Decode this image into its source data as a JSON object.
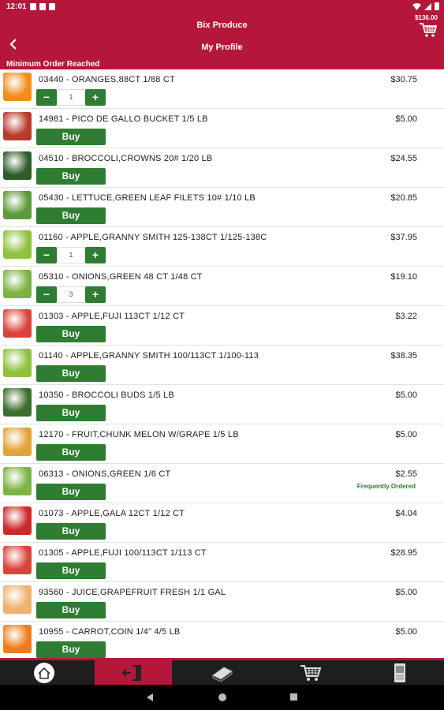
{
  "status_bar": {
    "time": "12:01"
  },
  "header": {
    "app_title": "Bix Produce",
    "screen_title": "My Profile",
    "cart_total": "$136.00",
    "min_order_text": "Minimum Order Reached"
  },
  "items": [
    {
      "desc": "03440 - ORANGES,88CT 1/88 CT",
      "price": "$30.75",
      "mode": "stepper",
      "qty": "1",
      "thumb": "#f28c1a"
    },
    {
      "desc": "14981 - PICO DE GALLO BUCKET 1/5 LB",
      "price": "$5.00",
      "mode": "buy",
      "button": "Buy",
      "thumb": "#b83a2b"
    },
    {
      "desc": "04510 - BROCCOLI,CROWNS 20# 1/20 LB",
      "price": "$24.55",
      "mode": "buy",
      "button": "Buy",
      "thumb": "#2f5d2a"
    },
    {
      "desc": "05430 - LETTUCE,GREEN LEAF FILETS 10# 1/10 LB",
      "price": "$20.85",
      "mode": "buy",
      "button": "Buy",
      "thumb": "#5d9a3b"
    },
    {
      "desc": "01160 - APPLE,GRANNY SMITH 125-138CT 1/125-138C",
      "price": "$37.95",
      "mode": "stepper",
      "qty": "1",
      "thumb": "#8fc13f"
    },
    {
      "desc": "05310 - ONIONS,GREEN 48 CT 1/48 CT",
      "price": "$19.10",
      "mode": "stepper",
      "qty": "3",
      "thumb": "#7cb342"
    },
    {
      "desc": "01303 - APPLE,FUJI 113CT 1/12 CT",
      "price": "$3.22",
      "mode": "buy",
      "button": "Buy",
      "thumb": "#d9443a"
    },
    {
      "desc": "01140 - APPLE,GRANNY SMITH 100/113CT 1/100-113",
      "price": "$38.35",
      "mode": "buy",
      "button": "Buy",
      "thumb": "#8fc13f"
    },
    {
      "desc": "10350 - BROCCOLI BUDS 1/5 LB",
      "price": "$5.00",
      "mode": "buy",
      "button": "Buy",
      "thumb": "#3c6e2f"
    },
    {
      "desc": "12170 - FRUIT,CHUNK MELON W/GRAPE 1/5 LB",
      "price": "$5.00",
      "mode": "buy",
      "button": "Buy",
      "thumb": "#e0a43a"
    },
    {
      "desc": "06313 - ONIONS,GREEN 1/6 CT",
      "price": "$2.55",
      "mode": "buy",
      "button": "Buy",
      "badge": "Frequently Ordered",
      "thumb": "#7cb342"
    },
    {
      "desc": "01073 - APPLE,GALA 12CT 1/12 CT",
      "price": "$4.04",
      "mode": "buy",
      "button": "Buy",
      "thumb": "#cc2a2a"
    },
    {
      "desc": "01305 - APPLE,FUJI 100/113CT 1/113 CT",
      "price": "$28.95",
      "mode": "buy",
      "button": "Buy",
      "thumb": "#d9443a"
    },
    {
      "desc": "93560 - JUICE,GRAPEFRUIT FRESH 1/1 GAL",
      "price": "$5.00",
      "mode": "buy",
      "button": "Buy",
      "thumb": "#f0b070"
    },
    {
      "desc": "10955 - CARROT,COIN 1/4\" 4/5 LB",
      "price": "$5.00",
      "mode": "buy",
      "button": "Buy",
      "thumb": "#ef7c1c"
    }
  ],
  "bottom_nav": [
    {
      "name": "home-icon",
      "active": false
    },
    {
      "name": "logout-icon",
      "active": true
    },
    {
      "name": "catalog-icon",
      "active": false
    },
    {
      "name": "cart-icon",
      "active": false
    },
    {
      "name": "phone-icon",
      "active": false
    }
  ],
  "colors": {
    "brand": "#b5173a",
    "button": "#2e7d32",
    "navbar": "#1e1e1e"
  }
}
